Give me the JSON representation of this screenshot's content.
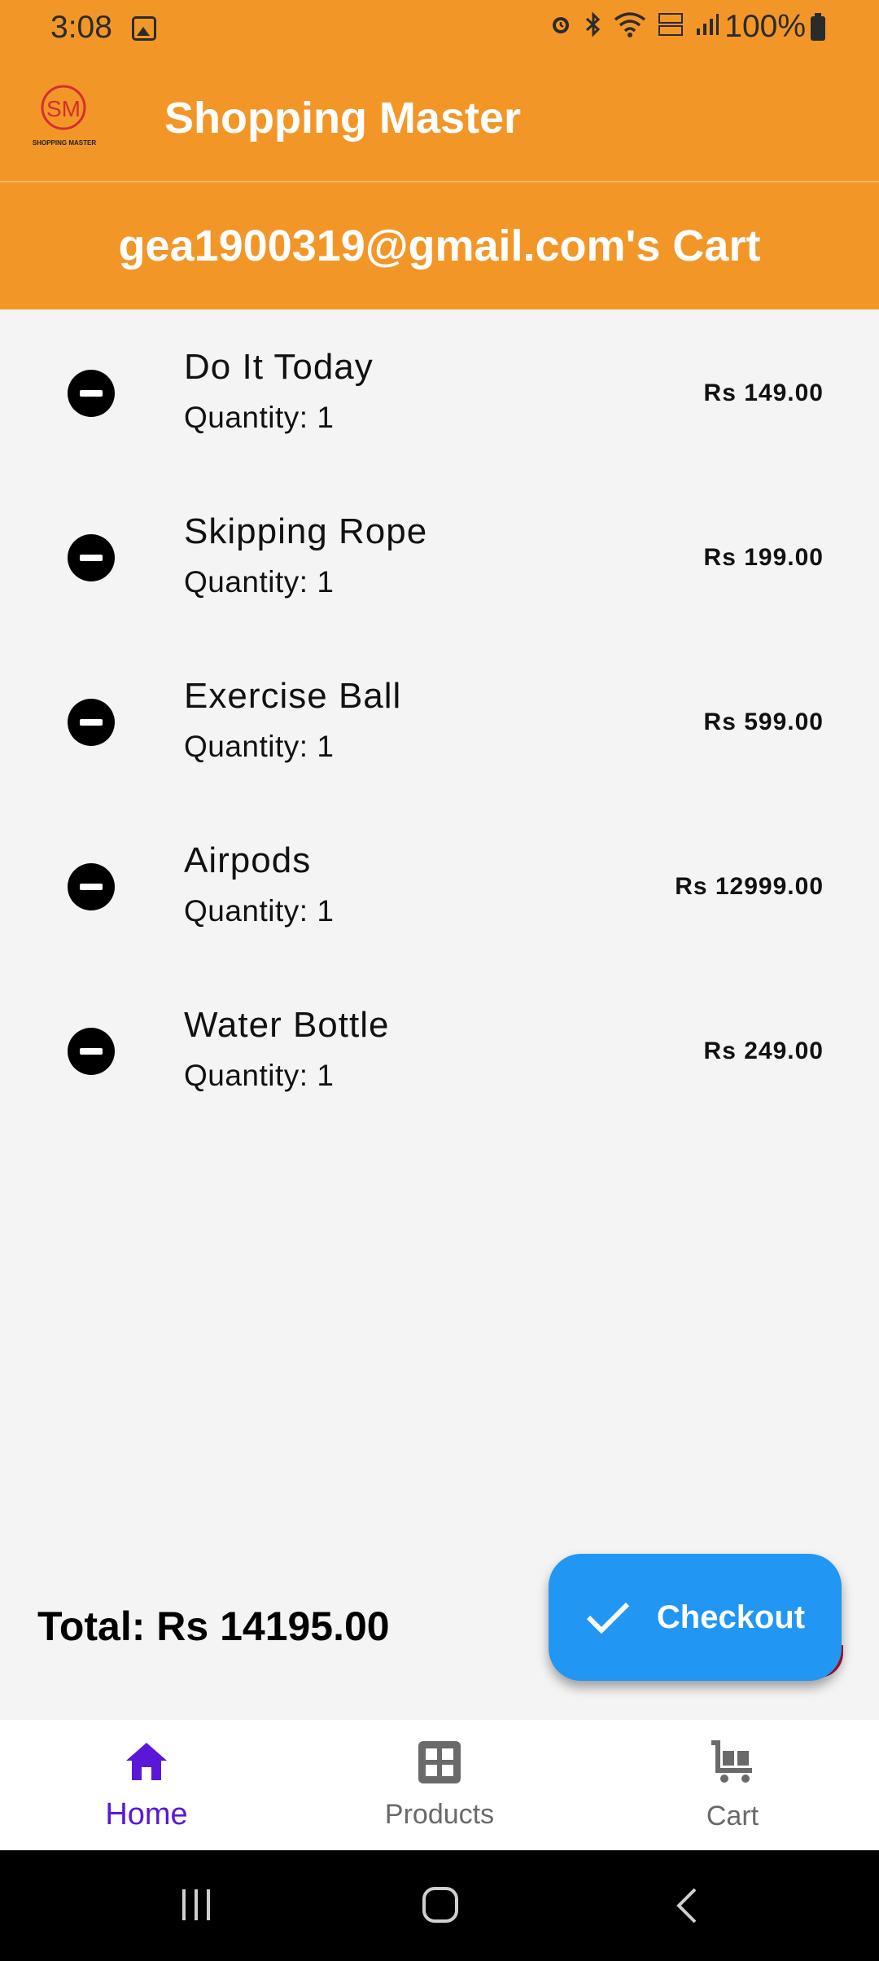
{
  "status_bar": {
    "time": "3:08",
    "battery": "100%"
  },
  "app": {
    "title": "Shopping Master",
    "logo_monogram": "SM",
    "logo_caption": "SHOPPING MASTER"
  },
  "cart": {
    "title": "gea1900319@gmail.com's Cart",
    "items": [
      {
        "name": "Do It Today",
        "quantity": "Quantity: 1",
        "price": "Rs 149.00"
      },
      {
        "name": "Skipping Rope",
        "quantity": "Quantity: 1",
        "price": "Rs 199.00"
      },
      {
        "name": "Exercise Ball",
        "quantity": "Quantity: 1",
        "price": "Rs 599.00"
      },
      {
        "name": "Airpods",
        "quantity": "Quantity: 1",
        "price": "Rs 12999.00"
      },
      {
        "name": "Water Bottle",
        "quantity": "Quantity: 1",
        "price": "Rs 249.00"
      }
    ],
    "total": "Total: Rs 14195.00",
    "checkout_label": "Checkout"
  },
  "bottom_nav": {
    "items": [
      {
        "label": "Home",
        "icon": "home-icon",
        "active": true
      },
      {
        "label": "Products",
        "icon": "grid-icon",
        "active": false
      },
      {
        "label": "Cart",
        "icon": "cart-icon",
        "active": false
      }
    ]
  },
  "colors": {
    "brand": "#f39628",
    "checkout": "#2196f3",
    "active_nav": "#5a17d8"
  }
}
